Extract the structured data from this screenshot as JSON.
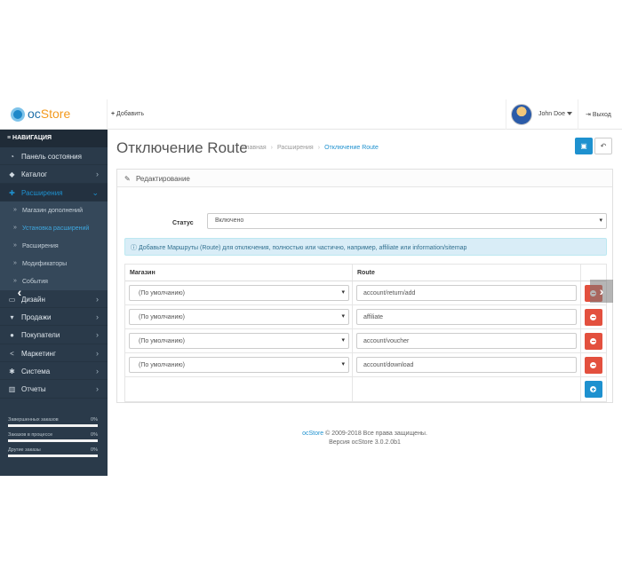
{
  "header": {
    "logo_text_a": "oc",
    "logo_text_b": "Store",
    "add_label": "Добавить",
    "user_name": "John Doe",
    "logout_label": "Выход"
  },
  "sidebar": {
    "title": "НАВИГАЦИЯ",
    "items": [
      {
        "label": "Панель состояния",
        "icon": "dashboard-icon"
      },
      {
        "label": "Каталог",
        "icon": "tag-icon"
      },
      {
        "label": "Расширения",
        "icon": "puzzle-icon"
      }
    ],
    "subitems": [
      {
        "label": "Магазин дополнений"
      },
      {
        "label": "Установка расширений"
      },
      {
        "label": "Расширения"
      },
      {
        "label": "Модификаторы"
      },
      {
        "label": "События"
      }
    ],
    "items2": [
      {
        "label": "Дизайн",
        "icon": "monitor-icon"
      },
      {
        "label": "Продажи",
        "icon": "cart-icon"
      },
      {
        "label": "Покупатели",
        "icon": "user-icon"
      },
      {
        "label": "Маркетинг",
        "icon": "share-icon"
      },
      {
        "label": "Система",
        "icon": "cog-icon"
      },
      {
        "label": "Отчеты",
        "icon": "bar-chart-icon"
      }
    ],
    "stats": [
      {
        "label": "Завершенных заказов",
        "pct": "0%"
      },
      {
        "label": "Заказов в процессе",
        "pct": "0%"
      },
      {
        "label": "Другие заказы",
        "pct": "0%"
      }
    ]
  },
  "page": {
    "title": "Отключение Route",
    "breadcrumb": [
      "Главная",
      "Расширения",
      "Отключение Route"
    ]
  },
  "panel": {
    "heading": "Редактирование",
    "status_label": "Статус",
    "status_value": "Включено",
    "info": "Добавьте Маршруты (Route) для отключения, полностью или частично, например, affiliate или information/sitemap",
    "columns": [
      "Магазин",
      "Route"
    ],
    "rows": [
      {
        "store": "(По умолчанию)",
        "route": "account/return/add"
      },
      {
        "store": "(По умолчанию)",
        "route": "affiliate"
      },
      {
        "store": "(По умолчанию)",
        "route": "account/voucher"
      },
      {
        "store": "(По умолчанию)",
        "route": "account/download"
      }
    ]
  },
  "footer": {
    "brand": "ocStore",
    "copyright": "© 2009-2018 Все права защищены.",
    "version": "Версия ocStore 3.0.2.0b1"
  },
  "colors": {
    "sidebar_bg": "#2a3a4a",
    "accent": "#1e91cf",
    "danger": "#e3503e",
    "info_bg": "#d9edf7"
  }
}
